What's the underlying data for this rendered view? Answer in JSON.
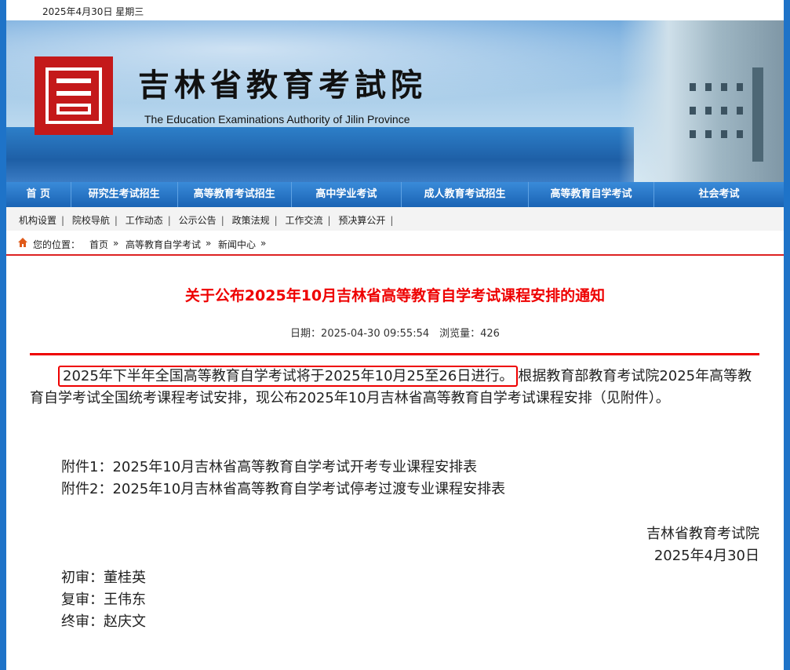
{
  "topbar": {
    "date": "2025年4月30日 星期三"
  },
  "banner": {
    "cn_title": "吉林省教育考試院",
    "en_title": "The Education Examinations Authority of Jilin Province",
    "logo_char": "吉"
  },
  "nav": {
    "items": [
      "首 页",
      "研究生考试招生",
      "高等教育考试招生",
      "高中学业考试",
      "成人教育考试招生",
      "高等教育自学考试",
      "社会考试"
    ]
  },
  "subnav": {
    "items": [
      "机构设置",
      "院校导航",
      "工作动态",
      "公示公告",
      "政策法规",
      "工作交流",
      "预决算公开"
    ]
  },
  "breadcrumb": {
    "label": "您的位置：",
    "items": [
      "首页",
      "高等教育自学考试",
      "新闻中心"
    ]
  },
  "article": {
    "title": "关于公布2025年10月吉林省高等教育自学考试课程安排的通知",
    "meta": "日期：2025-04-30 09:55:54　浏览量：426",
    "highlight": "2025年下半年全国高等教育自学考试将于2025年10月25至26日进行。",
    "para_rest": "根据教育部教育考试院2025年高等教育自学考试全国统考课程考试安排，现公布2025年10月吉林省高等教育自学考试课程安排（见附件）。",
    "attachment1": "附件1：2025年10月吉林省高等教育自学考试开考专业课程安排表",
    "attachment2": "附件2：2025年10月吉林省高等教育自学考试停考过渡专业课程安排表",
    "sign_org": "吉林省教育考试院",
    "sign_date": "2025年4月30日",
    "review1": "初审：董桂英",
    "review2": "复审：王伟东",
    "review3": "终审：赵庆文"
  },
  "colors": {
    "accent_red": "#e00000",
    "nav_blue": "#1a63b4"
  }
}
